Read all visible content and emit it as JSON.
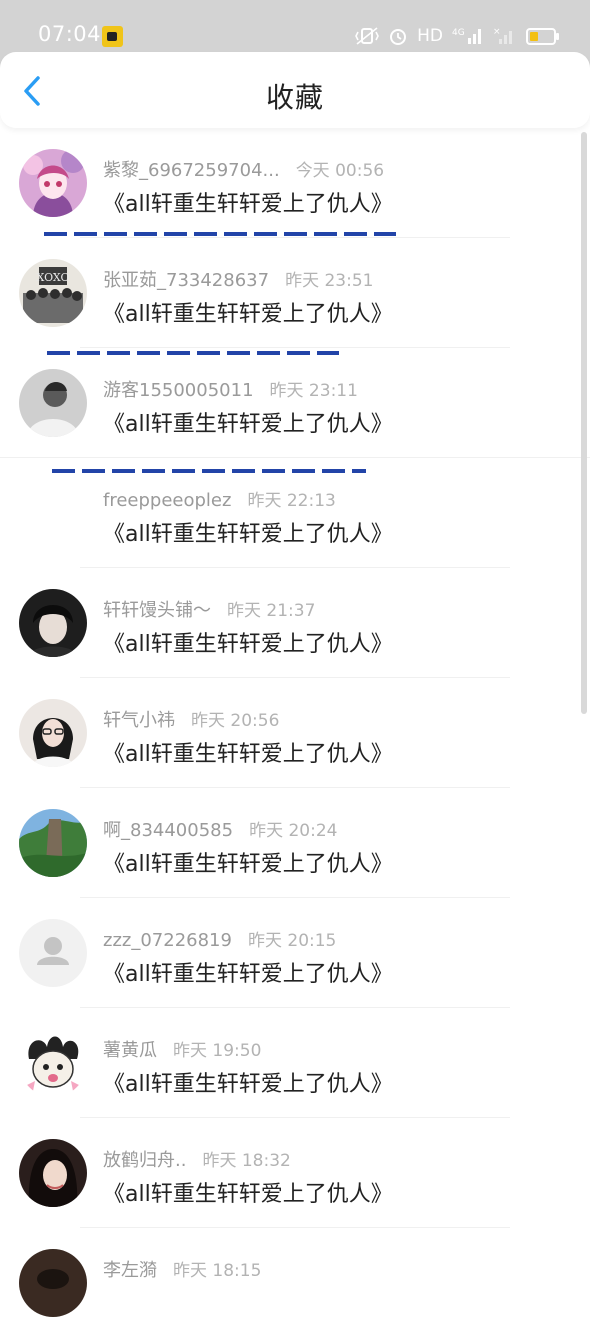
{
  "status_bar": {
    "time": "07:04",
    "hd_label": "HD",
    "network_label": "4G",
    "icons": [
      "vibrate-icon",
      "alarm-icon",
      "hd-icon",
      "signal-icon",
      "battery-icon"
    ]
  },
  "header": {
    "title": "收藏",
    "back_icon": "chevron-left-icon"
  },
  "colors": {
    "accent": "#2a9df4",
    "status_bar_bg": "#d3d3d3",
    "annotation_dash": "#2244a8"
  },
  "items": [
    {
      "name": "紫黎_6967259704...",
      "time": "今天 00:56",
      "book": "《all轩重生轩轩爱上了仇人》",
      "avatar": "anime-girl"
    },
    {
      "name": "张亚茹_733428637",
      "time": "昨天 23:51",
      "book": "《all轩重生轩轩爱上了仇人》",
      "avatar": "group-photo"
    },
    {
      "name": "游客1550005011",
      "time": "昨天 23:11",
      "book": "《all轩重生轩轩爱上了仇人》",
      "avatar": "person-gray"
    },
    {
      "name": "freeppeeoplez",
      "time": "昨天 22:13",
      "book": "《all轩重生轩轩爱上了仇人》",
      "avatar": "none"
    },
    {
      "name": "轩轩馒头铺～",
      "time": "昨天 21:37",
      "book": "《all轩重生轩轩爱上了仇人》",
      "avatar": "dark-boy"
    },
    {
      "name": "轩气小祎",
      "time": "昨天 20:56",
      "book": "《all轩重生轩轩爱上了仇人》",
      "avatar": "girl-glasses"
    },
    {
      "name": "啊_834400585",
      "time": "昨天 20:24",
      "book": "《all轩重生轩轩爱上了仇人》",
      "avatar": "landscape"
    },
    {
      "name": "zzz_07226819",
      "time": "昨天 20:15",
      "book": "《all轩重生轩轩爱上了仇人》",
      "avatar": "default"
    },
    {
      "name": "薯黄瓜",
      "time": "昨天 19:50",
      "book": "《all轩重生轩轩爱上了仇人》",
      "avatar": "meme-face"
    },
    {
      "name": "放鹤归舟..",
      "time": "昨天 18:32",
      "book": "《all轩重生轩轩爱上了仇人》",
      "avatar": "girl-dark-hair"
    },
    {
      "name": "李左漪",
      "time": "昨天 18:15",
      "book": "",
      "avatar": "partial"
    }
  ]
}
